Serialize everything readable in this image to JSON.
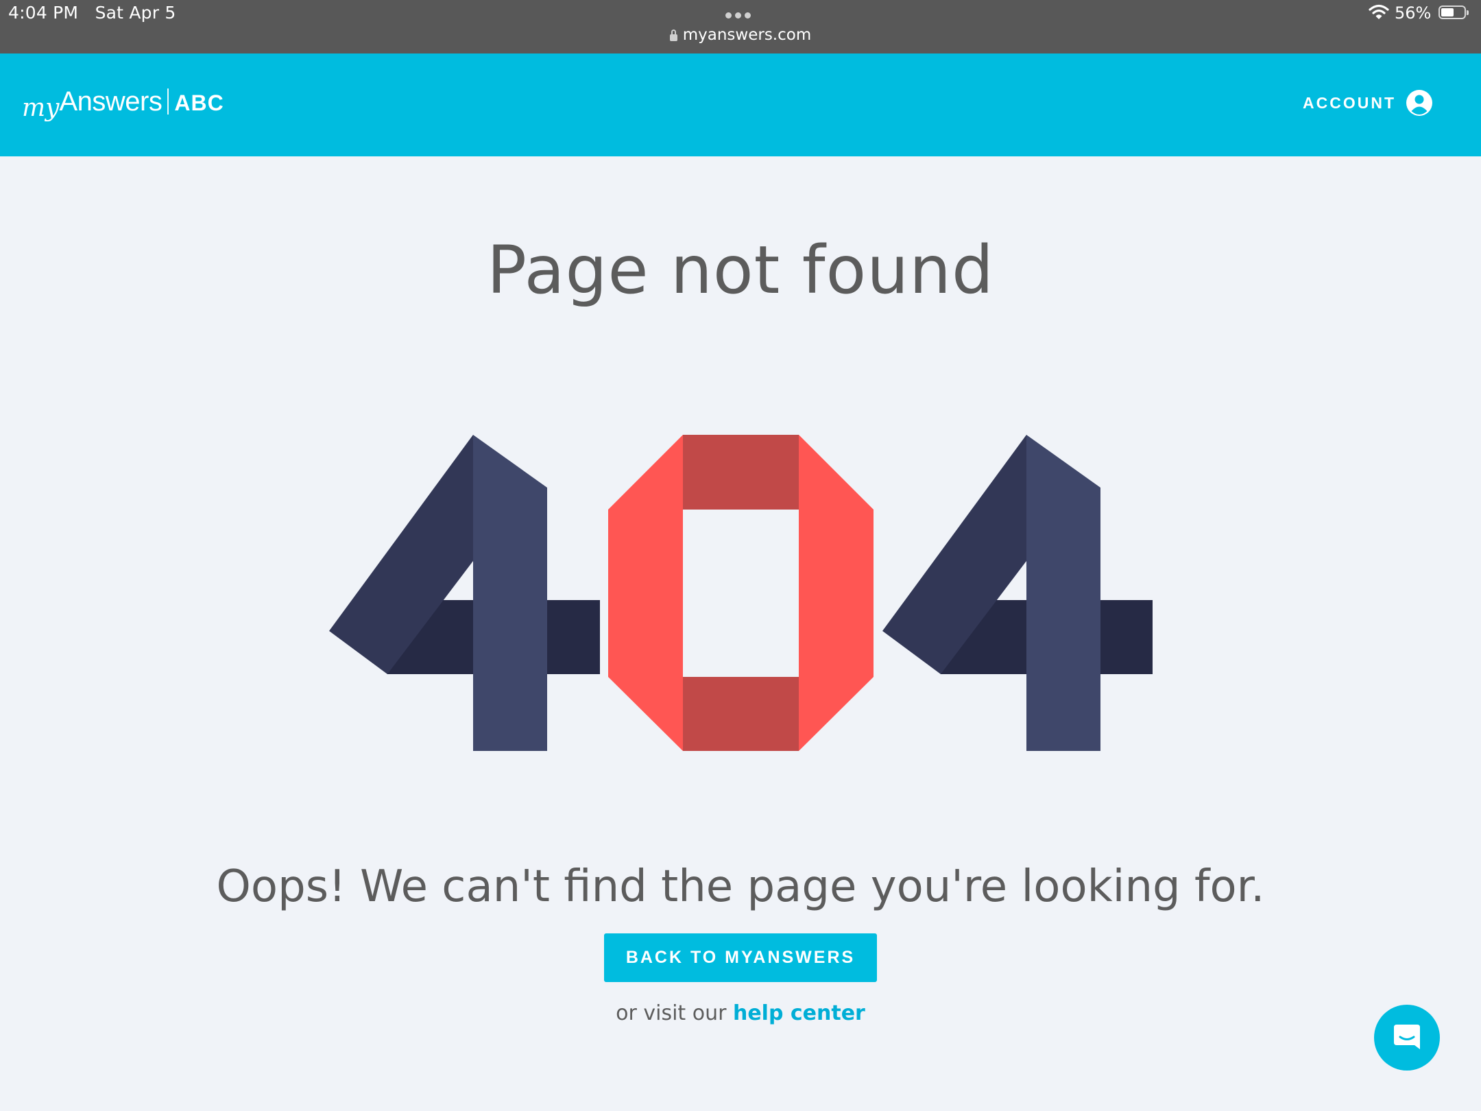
{
  "status_bar": {
    "time": "4:04 PM",
    "date": "Sat Apr 5",
    "url": "myanswers.com",
    "battery": "56%",
    "battery_level": 0.56
  },
  "header": {
    "logo_my": "my",
    "logo_answers": "Answers",
    "logo_abc": "ABC",
    "account_label": "ACCOUNT"
  },
  "main": {
    "title": "Page not found",
    "message": "Oops! We can't find the page you're looking for.",
    "back_button_label": "BACK TO MYANSWERS",
    "help_prefix": "or visit our",
    "help_link_label": "help center"
  },
  "colors": {
    "brand": "#00bcdf",
    "four_dark": "#323756",
    "four_light": "#3f476a",
    "four_bar": "#262a45",
    "zero_light": "#ff5653",
    "zero_dark": "#c14948"
  },
  "icons": {
    "account": "account-circle-icon",
    "chat": "chat-bubble-icon",
    "lock": "lock-icon",
    "wifi": "wifi-icon",
    "battery": "battery-icon"
  }
}
